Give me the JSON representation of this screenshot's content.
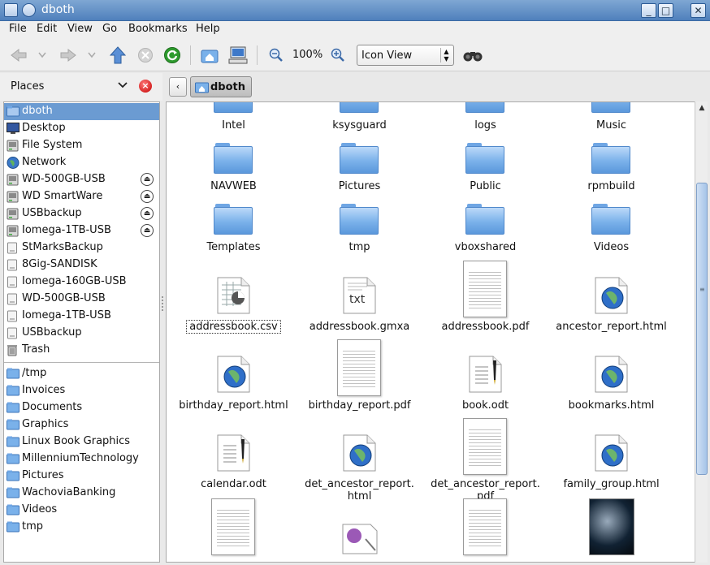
{
  "window": {
    "title": "dboth"
  },
  "menu": [
    "File",
    "Edit",
    "View",
    "Go",
    "Bookmarks",
    "Help"
  ],
  "toolbar": {
    "zoom": "100%",
    "view_mode": "Icon View"
  },
  "places": {
    "header": "Places",
    "items": [
      {
        "label": "dboth",
        "icon": "home-folder-icon",
        "selected": true
      },
      {
        "label": "Desktop",
        "icon": "desktop-icon"
      },
      {
        "label": "File System",
        "icon": "drive-icon"
      },
      {
        "label": "Network",
        "icon": "network-icon"
      },
      {
        "label": "WD-500GB-USB",
        "icon": "drive-icon",
        "eject": true
      },
      {
        "label": "WD SmartWare",
        "icon": "drive-icon",
        "eject": true
      },
      {
        "label": "USBbackup",
        "icon": "drive-icon",
        "eject": true
      },
      {
        "label": "Iomega-1TB-USB",
        "icon": "drive-icon",
        "eject": true
      },
      {
        "label": "StMarksBackup",
        "icon": "removable-drive-icon"
      },
      {
        "label": "8Gig-SANDISK",
        "icon": "removable-drive-icon"
      },
      {
        "label": "Iomega-160GB-USB",
        "icon": "removable-drive-icon"
      },
      {
        "label": "WD-500GB-USB",
        "icon": "removable-drive-icon"
      },
      {
        "label": "Iomega-1TB-USB",
        "icon": "removable-drive-icon"
      },
      {
        "label": "USBbackup",
        "icon": "removable-drive-icon"
      },
      {
        "label": "Trash",
        "icon": "trash-icon"
      }
    ],
    "bookmarks": [
      "/tmp",
      "Invoices",
      "Documents",
      "Graphics",
      "Linux Book Graphics",
      "MillenniumTechnology",
      "Pictures",
      "WachoviaBanking",
      "Videos",
      "tmp"
    ]
  },
  "location": {
    "crumb": "dboth"
  },
  "files": [
    {
      "name": "Intel",
      "type": "folder"
    },
    {
      "name": "ksysguard",
      "type": "folder"
    },
    {
      "name": "logs",
      "type": "folder"
    },
    {
      "name": "Music",
      "type": "folder"
    },
    {
      "name": "NAVWEB",
      "type": "folder"
    },
    {
      "name": "Pictures",
      "type": "folder"
    },
    {
      "name": "Public",
      "type": "folder"
    },
    {
      "name": "rpmbuild",
      "type": "folder"
    },
    {
      "name": "Templates",
      "type": "folder"
    },
    {
      "name": "tmp",
      "type": "folder"
    },
    {
      "name": "vboxshared",
      "type": "folder"
    },
    {
      "name": "Videos",
      "type": "folder"
    },
    {
      "name": "addressbook.csv",
      "type": "spreadsheet",
      "focused": true
    },
    {
      "name": "addressbook.gmxa",
      "type": "text",
      "badge": "txt"
    },
    {
      "name": "addressbook.pdf",
      "type": "pdf"
    },
    {
      "name": "ancestor_report.html",
      "type": "html"
    },
    {
      "name": "birthday_report.html",
      "type": "html"
    },
    {
      "name": "birthday_report.pdf",
      "type": "pdf"
    },
    {
      "name": "book.odt",
      "type": "odt"
    },
    {
      "name": "bookmarks.html",
      "type": "html"
    },
    {
      "name": "calendar.odt",
      "type": "odt"
    },
    {
      "name": "det_ancestor_report.\nhtml",
      "type": "html"
    },
    {
      "name": "det_ancestor_report.\npdf",
      "type": "pdf"
    },
    {
      "name": "family_group.html",
      "type": "html"
    },
    {
      "name": "",
      "type": "pdf"
    },
    {
      "name": "",
      "type": "image"
    },
    {
      "name": "",
      "type": "pdf"
    },
    {
      "name": "",
      "type": "photo"
    }
  ]
}
